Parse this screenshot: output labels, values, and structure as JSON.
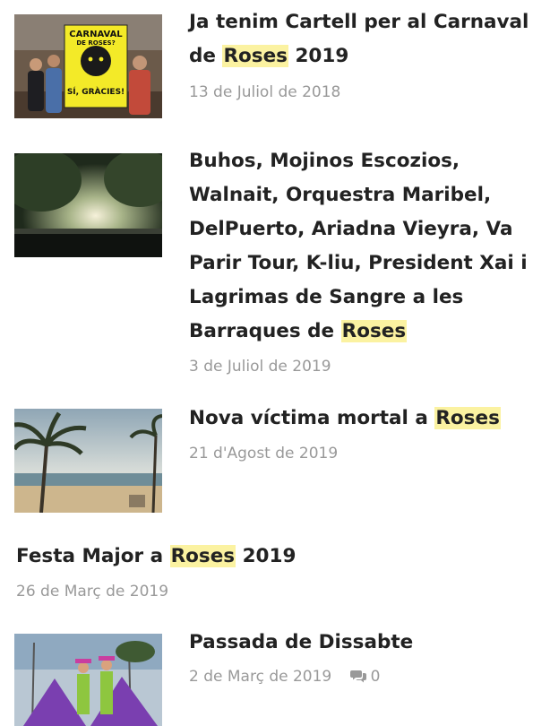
{
  "articles": [
    {
      "title_before": "Ja tenim Cartell per al Carnaval de ",
      "highlight": "Roses",
      "title_after": " 2019",
      "date": "13 de Juliol de 2018",
      "poster_line1": "CARNAVAL",
      "poster_line2": "DE ROSES?",
      "poster_line3": "SÍ, GRÀCIES!"
    },
    {
      "title_before": "Buhos, Mojinos Escozios, Walnait, Orquestra Maribel, DelPuerto, Ariadna Vieyra, Va Parir Tour, K-liu, President Xai i Lagrimas de Sangre a les Barraques de ",
      "highlight": "Roses",
      "title_after": "",
      "date": "3 de Juliol de 2019"
    },
    {
      "title_before": "Nova víctima mortal a ",
      "highlight": "Roses",
      "title_after": "",
      "date": "21 d'Agost de 2019"
    },
    {
      "title_before": "Festa Major a ",
      "highlight": "Roses",
      "title_after": " 2019",
      "date": "26 de Març de 2019"
    },
    {
      "title_before": "Passada de Dissabte",
      "highlight": "",
      "title_after": "",
      "date": "2 de Març de 2019",
      "comment_count": "0",
      "comment_icon": "speech-bubble-icon"
    }
  ],
  "colors": {
    "title": "#222222",
    "highlight": "#fbf2a1",
    "meta": "#999999"
  }
}
